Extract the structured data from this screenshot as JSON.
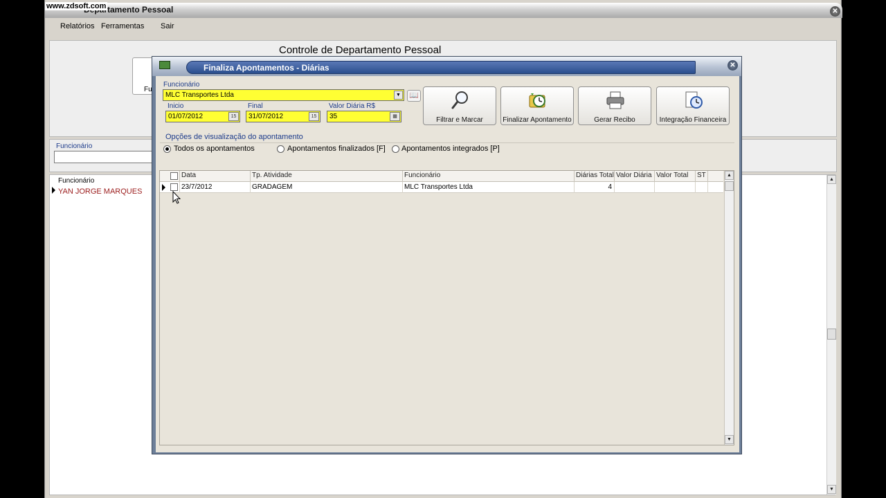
{
  "watermark": "www.zdsoft.com",
  "main_window": {
    "title": "Departamento Pessoal",
    "close_glyph": "✕"
  },
  "menu": {
    "items": [
      "Relatórios",
      "Ferramentas",
      "Sair"
    ]
  },
  "header": {
    "title": "Controle de Departamento Pessoal",
    "tile_label": "Fu"
  },
  "filter": {
    "label": "Funcionário",
    "value": ""
  },
  "employee_list": {
    "header": "Funcionário",
    "rows": [
      "YAN JORGE MARQUES"
    ],
    "scroll_up": "▲",
    "scroll_down": "▼"
  },
  "dialog": {
    "title": "Finaliza Apontamentos - Diárias",
    "close_glyph": "✕",
    "funcionario": {
      "label": "Funcionário",
      "value": "MLC Transportes Ltda",
      "arrow": "▼"
    },
    "inicio": {
      "label": "Inicio",
      "value": "01/07/2012",
      "btn": "15"
    },
    "final": {
      "label": "Final",
      "value": "31/07/2012",
      "btn": "15"
    },
    "valor_diaria": {
      "label": "Valor Diária R$",
      "value": "35",
      "btn": "▦"
    },
    "book_icon": "📖",
    "buttons": {
      "filtrar": "Filtrar e Marcar",
      "finalizar": "Finalizar Apontamento",
      "recibo": "Gerar Recibo",
      "integracao": "Integração Financeira"
    },
    "options": {
      "title": "Opções de visualização do apontamento",
      "todos": "Todos os apontamentos",
      "finalizados": "Apontamentos finalizados [F]",
      "integrados": "Apontamentos integrados [P]",
      "selected": "todos"
    },
    "grid": {
      "columns": [
        "Data",
        "Tp. Atividade",
        "Funcionário",
        "Diárias Total",
        "Valor Diária",
        "Valor Total",
        "ST"
      ],
      "rows": [
        {
          "data": "23/7/2012",
          "atividade": "GRADAGEM",
          "funcionario": "MLC Transportes Ltda",
          "diarias": "4",
          "valor_diaria": "",
          "valor_total": "",
          "st": ""
        }
      ],
      "scroll_up": "▲",
      "scroll_down": "▼"
    }
  },
  "colors": {
    "required_field": "#ffff33",
    "dialog_title_bar": "#2b4f8e",
    "label_blue": "#1b3a8a",
    "list_name_red": "#9b1c1c"
  }
}
